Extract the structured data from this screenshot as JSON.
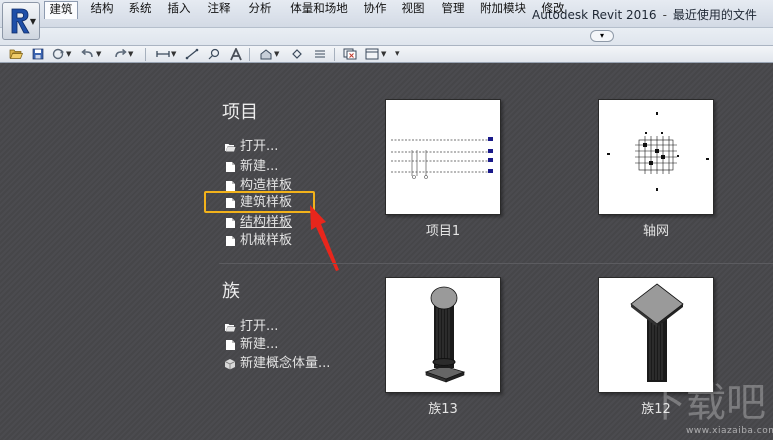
{
  "window": {
    "title_app": "Autodesk Revit 2016",
    "title_sep": "-",
    "title_page": "最近使用的文件"
  },
  "ribbon": {
    "tabs": [
      "建筑",
      "结构",
      "系统",
      "插入",
      "注释",
      "分析",
      "体量和场地",
      "协作",
      "视图",
      "管理",
      "附加模块",
      "修改"
    ],
    "active_tab": "建筑"
  },
  "projects": {
    "heading": "项目",
    "links": [
      {
        "label": "打开...",
        "icon": "folder-open-icon"
      },
      {
        "label": "新建...",
        "icon": "document-icon"
      },
      {
        "label": "构造样板",
        "icon": "document-icon"
      },
      {
        "label": "建筑样板",
        "icon": "document-icon"
      },
      {
        "label": "结构样板",
        "icon": "document-icon"
      },
      {
        "label": "机械样板",
        "icon": "document-icon"
      }
    ],
    "recent": [
      {
        "label": "项目1"
      },
      {
        "label": "轴网"
      }
    ]
  },
  "families": {
    "heading": "族",
    "links": [
      {
        "label": "打开...",
        "icon": "folder-open-icon"
      },
      {
        "label": "新建...",
        "icon": "document-icon"
      },
      {
        "label": "新建概念体量...",
        "icon": "cube-icon"
      }
    ],
    "recent": [
      {
        "label": "族13"
      },
      {
        "label": "族12"
      }
    ]
  },
  "colors": {
    "highlight_box": "#f2b21b",
    "annotation_arrow": "#e8261c",
    "background": "#4a4a4e"
  },
  "watermark": {
    "glyphs": "下载吧",
    "text": "www.xiazaiba.com"
  }
}
